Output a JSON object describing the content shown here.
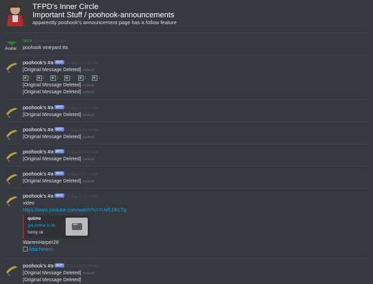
{
  "header": {
    "guild_name": "TFPD's Inner Circle",
    "channel": "Important Stuff / poohook-announcements",
    "topic": "apparently poohook's announcement page has a follow feature"
  },
  "colors": {
    "background": "#36393f",
    "bot_badge": "#7289da",
    "link": "#00aff4",
    "green_name": "#3ba55d"
  },
  "messages": [
    {
      "author": "aizx",
      "time": "16-Aug-20 01:13 AM",
      "lines": [
        "poohook vineyard #a"
      ]
    },
    {
      "author": "poohook's #a",
      "bot": "BOT",
      "time": "16-Aug-20 01:35 PM",
      "line1": "[Original Message Deleted]",
      "edited": "(edited)",
      "reactions": [
        "2",
        "2",
        "2",
        "2",
        "2",
        "1"
      ],
      "line2": "[Original Message Deleted]",
      "line3": "[Original Message Deleted]"
    },
    {
      "author": "poohook's #a",
      "bot": "BOT",
      "time": "16-Aug-20 03:23 PM",
      "line1": "[Original Message Deleted]",
      "edited": "(edited)"
    },
    {
      "author": "poohook's #a",
      "bot": "BOT",
      "time": "16-Aug-20 05:33 PM",
      "line1": "[Original Message Deleted]",
      "edited": "(edited)"
    },
    {
      "author": "poohook's #a",
      "bot": "BOT",
      "time": "16-Aug-20 06:04 PM",
      "line1": "[Original Message Deleted]",
      "edited": "(edited)"
    },
    {
      "author": "poohook's #a",
      "bot": "BOT",
      "time": "16-Aug-20 07:43 PM",
      "line1": "[Original Message Deleted]",
      "edited": "(edited)"
    },
    {
      "author": "poohook's #a",
      "bot": "BOT",
      "time": "17-Aug-20 12:33 AM",
      "line1": "video",
      "link": "https://www.youtube.com/watch?v=YUvfLDKLTg",
      "embed": {
        "provider": "quizno",
        "title": "gta online is ok",
        "description": "funny ok"
      },
      "after_embed": "WarrenHarper28",
      "attachment": "Attachment"
    },
    {
      "author": "poohook's #a",
      "bot": "BOT",
      "time": "17-Aug-20 01:38 AM",
      "line1": "[Original Message Deleted]",
      "edited": "(edited)",
      "line2": "[Original Message Deleted]"
    }
  ],
  "avatar_alt": "Avatar"
}
